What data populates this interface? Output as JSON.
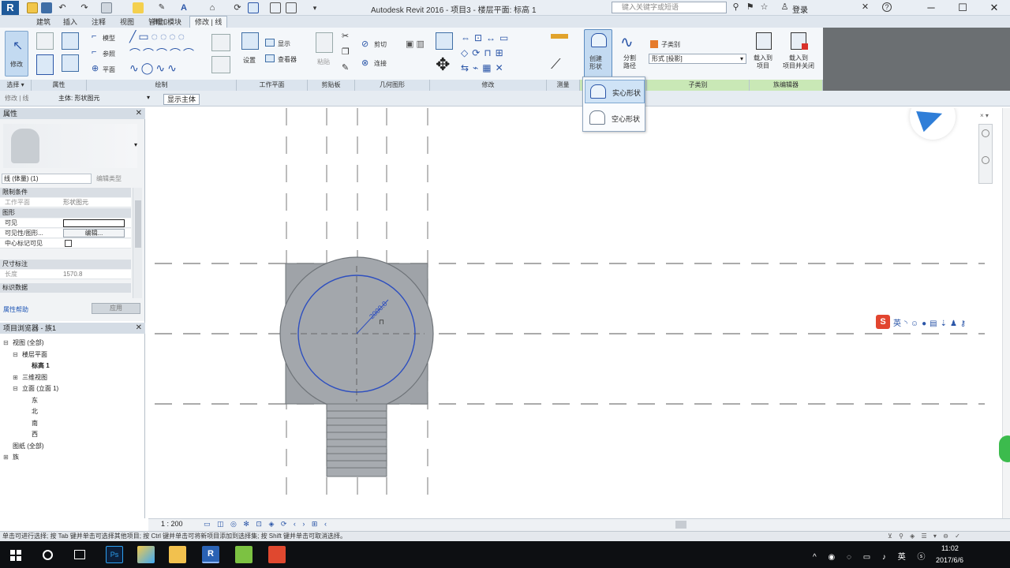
{
  "titlebar": {
    "app_logo": "R",
    "title": "Autodesk Revit 2016 -    项目3 - 楼层平面: 标高 1",
    "search_placeholder": "键入关键字或短语",
    "login_label": "登录",
    "help_label": "?"
  },
  "ribbon_tabs": [
    "建筑",
    "插入",
    "注释",
    "视图",
    "管理",
    "附加模块",
    "修改 | 线"
  ],
  "ribbon": {
    "select_panel": {
      "modify_label": "修改",
      "label": "选择",
      "dropdown_arrow": "▾"
    },
    "properties_panel": {
      "label": "属性"
    },
    "draw_panel": {
      "label": "绘制",
      "items": [
        "模型",
        "参照",
        "平面"
      ]
    },
    "workplane_panel": {
      "label": "工作平面",
      "set_label": "设置",
      "show_label": "显示",
      "viewer_label": "查看器"
    },
    "clipboard_panel": {
      "label": "剪贴板",
      "paste_label": "粘贴"
    },
    "geometry_panel": {
      "label": "几何图形",
      "cut_label": "剪切",
      "join_label": "连接"
    },
    "modify_panel": {
      "label": "修改"
    },
    "measure_panel": {
      "label": "测量"
    },
    "form_panel": {
      "create_form_label": "创建\n形状",
      "divide_path_label": "分割\n路径"
    },
    "subcategory_panel": {
      "label": "子类别",
      "subcategory_label": "子类别",
      "dropdown_value": "形式 [投影]"
    },
    "family_editor_panel": {
      "label": "族编辑器",
      "load_project_label": "载入到\n项目",
      "load_close_label": "载入到\n项目并关闭"
    }
  },
  "create_form_dropdown": {
    "items": [
      {
        "label": "实心形状",
        "active": true
      },
      {
        "label": "空心形状",
        "active": false
      }
    ]
  },
  "options_bar": {
    "modify_label": "修改 | 线",
    "active_view_label": "主体: 形状图元",
    "view_tab": "显示主体"
  },
  "properties": {
    "title": "属性",
    "type_selector": "线 (体量) (1)",
    "edit_type": "编辑类型",
    "groups": [
      {
        "name": "限制条件",
        "rows": [
          {
            "name": "工作平面",
            "value": "形状图元",
            "dim": true
          }
        ]
      },
      {
        "name": "图形",
        "rows": [
          {
            "name": "可见",
            "value": ""
          },
          {
            "name": "可见性/图形...",
            "value": "编辑..."
          },
          {
            "name": "中心标记可见",
            "value": ""
          }
        ]
      },
      {
        "name": "尺寸标注",
        "rows": [
          {
            "name": "长度",
            "value": "1570.8",
            "dim": true
          }
        ]
      },
      {
        "name": "标识数据",
        "rows": []
      }
    ],
    "help_link": "属性帮助",
    "apply_button": "应用"
  },
  "browser": {
    "title": "项目浏览器 - 族1",
    "tree": [
      {
        "label": "视图 (全部)",
        "level": 0,
        "toggle": "⊟"
      },
      {
        "label": "楼层平面",
        "level": 1,
        "toggle": "⊟"
      },
      {
        "label": "标高 1",
        "level": 2,
        "toggle": "",
        "bold": true
      },
      {
        "label": "三维视图",
        "level": 1,
        "toggle": "⊞"
      },
      {
        "label": "立面 (立面 1)",
        "level": 1,
        "toggle": "⊟"
      },
      {
        "label": "东",
        "level": 2,
        "toggle": ""
      },
      {
        "label": "北",
        "level": 2,
        "toggle": ""
      },
      {
        "label": "南",
        "level": 2,
        "toggle": ""
      },
      {
        "label": "西",
        "level": 2,
        "toggle": ""
      },
      {
        "label": "图纸 (全部)",
        "level": 0,
        "toggle": ""
      },
      {
        "label": "族",
        "level": 0,
        "toggle": "⊞"
      }
    ]
  },
  "canvas": {
    "dimension_text": "2000.0",
    "scale": "1 : 200"
  },
  "status_bar": {
    "text": "单击可进行选择; 按 Tab 键并单击可选择其他项目; 按 Ctrl 键并单击可将新项目添加到选择集; 按 Shift 键并单击可取消选择。"
  },
  "taskbar": {
    "time": "11:02",
    "date": "2017/6/6"
  },
  "colors": {
    "accent": "#3f6ea6",
    "mass_fill": "#9fa3a8",
    "selected_blue": "#2e4fbf",
    "ime_red": "#e2452f"
  }
}
